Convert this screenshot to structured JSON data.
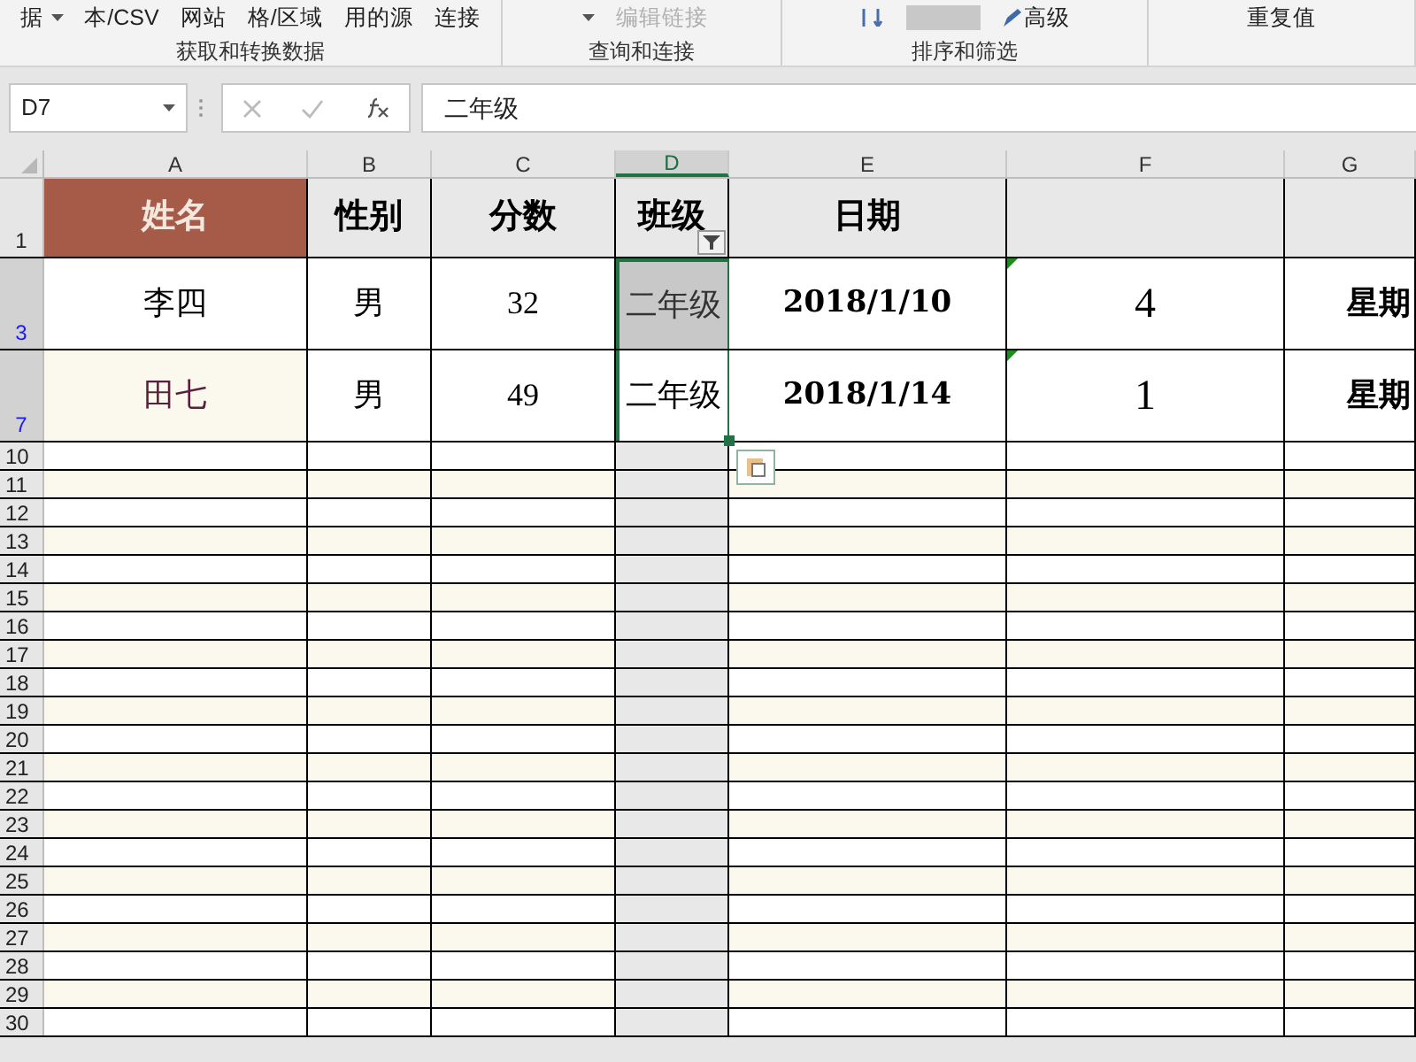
{
  "ribbon": {
    "groups": [
      {
        "label": "获取和转换数据",
        "items": [
          {
            "text": "据",
            "caret": true,
            "disabled": false
          },
          {
            "text": "本/CSV",
            "caret": false,
            "disabled": false
          },
          {
            "text": "网站",
            "caret": false,
            "disabled": false
          },
          {
            "text": "格/区域",
            "caret": false,
            "disabled": false
          },
          {
            "text": "用的源",
            "caret": false,
            "disabled": false
          },
          {
            "text": "连接",
            "caret": false,
            "disabled": false
          }
        ]
      },
      {
        "label": "查询和连接",
        "items": [
          {
            "text": "编辑链接",
            "caret": false,
            "disabled": true
          }
        ]
      },
      {
        "label": "排序和筛选",
        "items": [
          {
            "text": "高级",
            "caret": false,
            "disabled": false
          }
        ]
      },
      {
        "items": [
          {
            "text": "重复值",
            "caret": false,
            "disabled": false
          }
        ]
      }
    ]
  },
  "formula_bar": {
    "name_box": "D7",
    "value": "二年级"
  },
  "columns": [
    {
      "label": "A",
      "selected": false
    },
    {
      "label": "B",
      "selected": false
    },
    {
      "label": "C",
      "selected": false
    },
    {
      "label": "D",
      "selected": true
    },
    {
      "label": "E",
      "selected": false
    },
    {
      "label": "F",
      "selected": false
    },
    {
      "label": "G",
      "selected": false
    }
  ],
  "rows": [
    {
      "number": "1",
      "kind": "header",
      "filtered": false,
      "cells": [
        {
          "text": "姓名",
          "kind": "accent",
          "flag": false
        },
        {
          "text": "性别",
          "kind": "none",
          "flag": false
        },
        {
          "text": "分数",
          "kind": "none",
          "flag": false
        },
        {
          "text": "班级",
          "kind": "none",
          "flag": false,
          "filter": true
        },
        {
          "text": "日期",
          "kind": "none",
          "flag": false
        },
        {
          "kind": "none",
          "flag": false
        },
        {
          "kind": "none",
          "flag": false
        }
      ]
    },
    {
      "number": "3",
      "kind": "data",
      "filtered": true,
      "cells": [
        {
          "text": "李四",
          "kind": "white",
          "flag": false
        },
        {
          "text": "男",
          "kind": "white",
          "flag": false
        },
        {
          "text": "32",
          "kind": "white",
          "flag": false
        },
        {
          "text": "二年级",
          "kind": "grey",
          "flag": false
        },
        {
          "text": "2018/1/10",
          "kind": "white",
          "flag": false
        },
        {
          "text": "4",
          "kind": "white",
          "flag": true
        },
        {
          "text": "星期",
          "kind": "white",
          "flag": false
        }
      ]
    },
    {
      "number": "7",
      "kind": "data",
      "filtered": true,
      "cells": [
        {
          "text": "田七",
          "kind": "cream",
          "flag": false
        },
        {
          "text": "男",
          "kind": "white",
          "flag": false
        },
        {
          "text": "49",
          "kind": "white",
          "flag": false
        },
        {
          "text": "二年级",
          "kind": "white",
          "flag": false
        },
        {
          "text": "2018/1/14",
          "kind": "white",
          "flag": false
        },
        {
          "text": "1",
          "kind": "white",
          "flag": true
        },
        {
          "text": "星期",
          "kind": "white",
          "flag": false
        }
      ]
    }
  ],
  "empty_rows": [
    "10",
    "11",
    "12",
    "13",
    "14",
    "15",
    "16",
    "17",
    "18",
    "19",
    "20",
    "21",
    "22",
    "23",
    "24",
    "25",
    "26",
    "27",
    "28",
    "29",
    "30"
  ]
}
